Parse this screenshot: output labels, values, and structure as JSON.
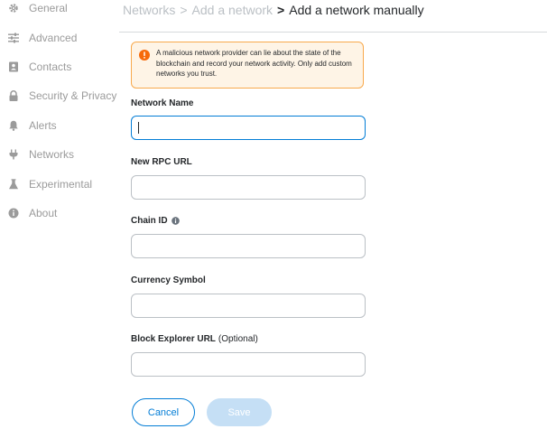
{
  "sidebar": {
    "items": [
      {
        "label": "General",
        "icon": "gear-icon"
      },
      {
        "label": "Advanced",
        "icon": "sliders-icon"
      },
      {
        "label": "Contacts",
        "icon": "address-book-icon"
      },
      {
        "label": "Security & Privacy",
        "icon": "lock-icon"
      },
      {
        "label": "Alerts",
        "icon": "bell-icon"
      },
      {
        "label": "Networks",
        "icon": "plug-icon"
      },
      {
        "label": "Experimental",
        "icon": "flask-icon"
      },
      {
        "label": "About",
        "icon": "info-icon"
      }
    ]
  },
  "breadcrumb": {
    "items": [
      "Networks",
      "Add a network"
    ],
    "separator": ">",
    "current": "Add a network manually"
  },
  "warning": {
    "text": "A malicious network provider can lie about the state of the blockchain and record your network activity. Only add custom networks you trust.",
    "icon": "warning-icon"
  },
  "form": {
    "network_name": {
      "label": "Network Name",
      "value": "",
      "placeholder": ""
    },
    "rpc_url": {
      "label": "New RPC URL",
      "value": "",
      "placeholder": ""
    },
    "chain_id": {
      "label": "Chain ID",
      "value": "",
      "placeholder": "",
      "icon": "info-icon"
    },
    "currency_symbol": {
      "label": "Currency Symbol",
      "value": "",
      "placeholder": ""
    },
    "block_explorer": {
      "label": "Block Explorer URL",
      "optional": "(Optional)",
      "value": "",
      "placeholder": ""
    }
  },
  "buttons": {
    "cancel": "Cancel",
    "save": "Save"
  },
  "colors": {
    "accent": "#037dd6",
    "warning_border": "#f8a94c",
    "warning_bg": "#fef4e6",
    "warning_icon": "#f66a0a",
    "sidebar_text": "#9b9b9b",
    "disabled_button": "#c5dff5"
  }
}
